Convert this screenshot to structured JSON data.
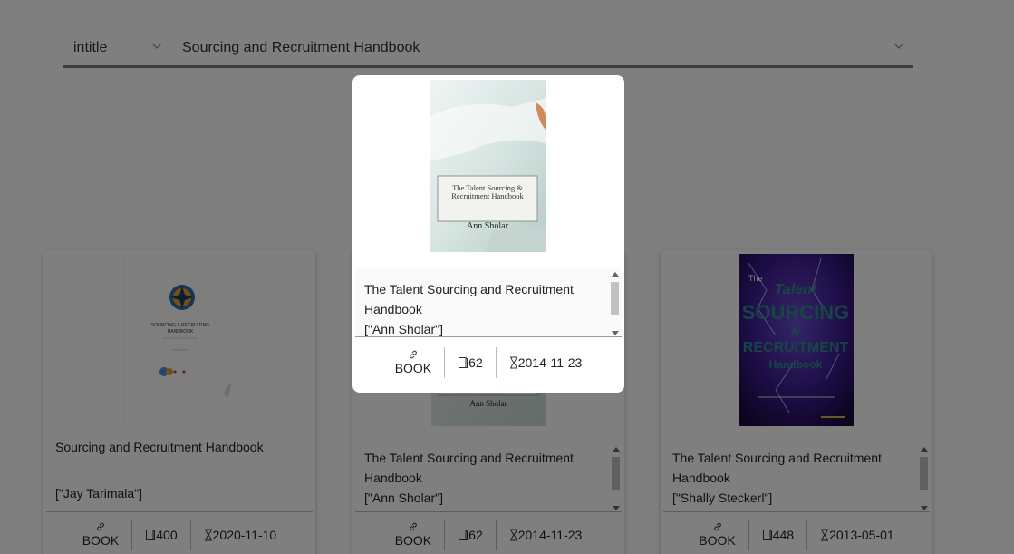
{
  "search": {
    "field_type": "intitle",
    "query": "Sourcing and Recruitment Handbook"
  },
  "results": [
    {
      "title": "Sourcing and Recruitment Handbook",
      "authors": "[\"Jay Tarimala\"]",
      "link_label": "BOOK",
      "pages": "400",
      "date": "2020-11-10"
    },
    {
      "title": "The Talent Sourcing and Recruitment Handbook",
      "authors": "[\"Ann Sholar\"]",
      "link_label": "BOOK",
      "pages": "62",
      "date": "2014-11-23",
      "cover_author": "Ann Sholar"
    },
    {
      "title": "The Talent Sourcing and Recruitment Handbook",
      "authors": "[\"Shally Steckerl\"]",
      "link_label": "BOOK",
      "pages": "448",
      "date": "2013-05-01",
      "cover_text": {
        "line1": "The",
        "line2": "Talent",
        "line3": "SOURCING",
        "line4": "&",
        "line5": "RECRUITMENT",
        "line6": "Handbook"
      }
    }
  ],
  "cover_one": {
    "line1": "SOURCING & RECRUITING",
    "line2": "HANDBOOK"
  },
  "modal": {
    "title": "The Talent Sourcing and Recruitment Handbook",
    "authors": "[\"Ann Sholar\"]",
    "link_label": "BOOK",
    "pages": "62",
    "date": "2014-11-23",
    "cover_title_line1": "The Talent Sourcing &",
    "cover_title_line2": "Recruitment Handbook",
    "cover_author": "Ann Sholar"
  },
  "colors": {
    "overlay": "rgba(0,0,0,0.5)",
    "card_background": "#ffffff",
    "purple_cover": "#3a1a6e",
    "teal_cover_text": "#2e8a8a"
  }
}
